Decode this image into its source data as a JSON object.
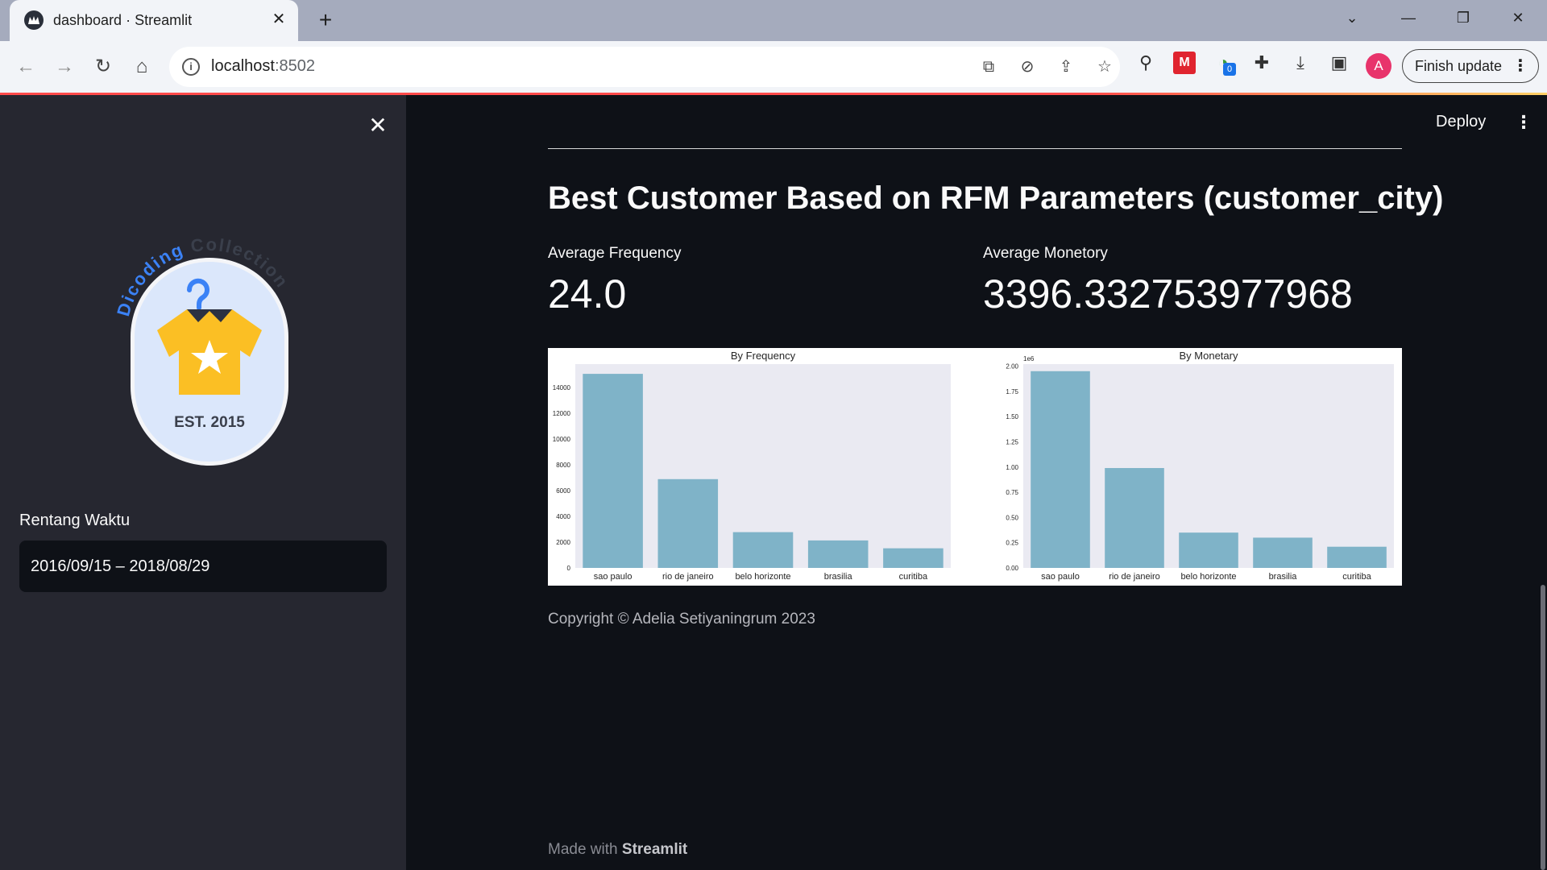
{
  "browser": {
    "tab_title": "dashboard · Streamlit",
    "url_host": "localhost",
    "url_port": ":8502",
    "finish_update_label": "Finish update",
    "avatar_letter": "A",
    "ext_badge": "0"
  },
  "sidebar": {
    "logo_text_top": "Dicoding Collection",
    "logo_text_bottom": "EST. 2015",
    "date_label": "Rentang Waktu",
    "date_value": "2016/09/15 – 2018/08/29"
  },
  "main": {
    "deploy_label": "Deploy",
    "title": "Best Customer Based on RFM Parameters (customer_city)",
    "metrics": [
      {
        "label": "Average Frequency",
        "value": "24.0"
      },
      {
        "label": "Average Monetory",
        "value": "3396.332753977968"
      }
    ],
    "copyright": "Copyright © Adelia Setiyaningrum 2023",
    "footer_prefix": "Made with",
    "footer_brand": "Streamlit"
  },
  "colors": {
    "bar": "#7fb3c8",
    "plot_bg": "#eaeaf2",
    "app_bg": "#0e1117",
    "sidebar_bg": "#262730",
    "accent_red": "#ff4b4b"
  },
  "chart_data": [
    {
      "type": "bar",
      "title": "By Frequency",
      "categories": [
        "sao paulo",
        "rio de janeiro",
        "belo horizonte",
        "brasilia",
        "curitiba"
      ],
      "values": [
        15045,
        6882,
        2773,
        2131,
        1521
      ],
      "ylim": [
        0,
        15800
      ],
      "yticks": [
        0,
        2000,
        4000,
        6000,
        8000,
        10000,
        12000,
        14000
      ],
      "xlabel": "",
      "ylabel": "",
      "grid": false
    },
    {
      "type": "bar",
      "title": "By Monetary",
      "categories": [
        "sao paulo",
        "rio de janeiro",
        "belo horizonte",
        "brasilia",
        "curitiba"
      ],
      "values": [
        1.95,
        0.99,
        0.35,
        0.3,
        0.21
      ],
      "y_scale_label": "1e6",
      "ylim": [
        0,
        2.02
      ],
      "yticks": [
        0.0,
        0.25,
        0.5,
        0.75,
        1.0,
        1.25,
        1.5,
        1.75,
        2.0
      ],
      "xlabel": "",
      "ylabel": "",
      "grid": false
    }
  ]
}
